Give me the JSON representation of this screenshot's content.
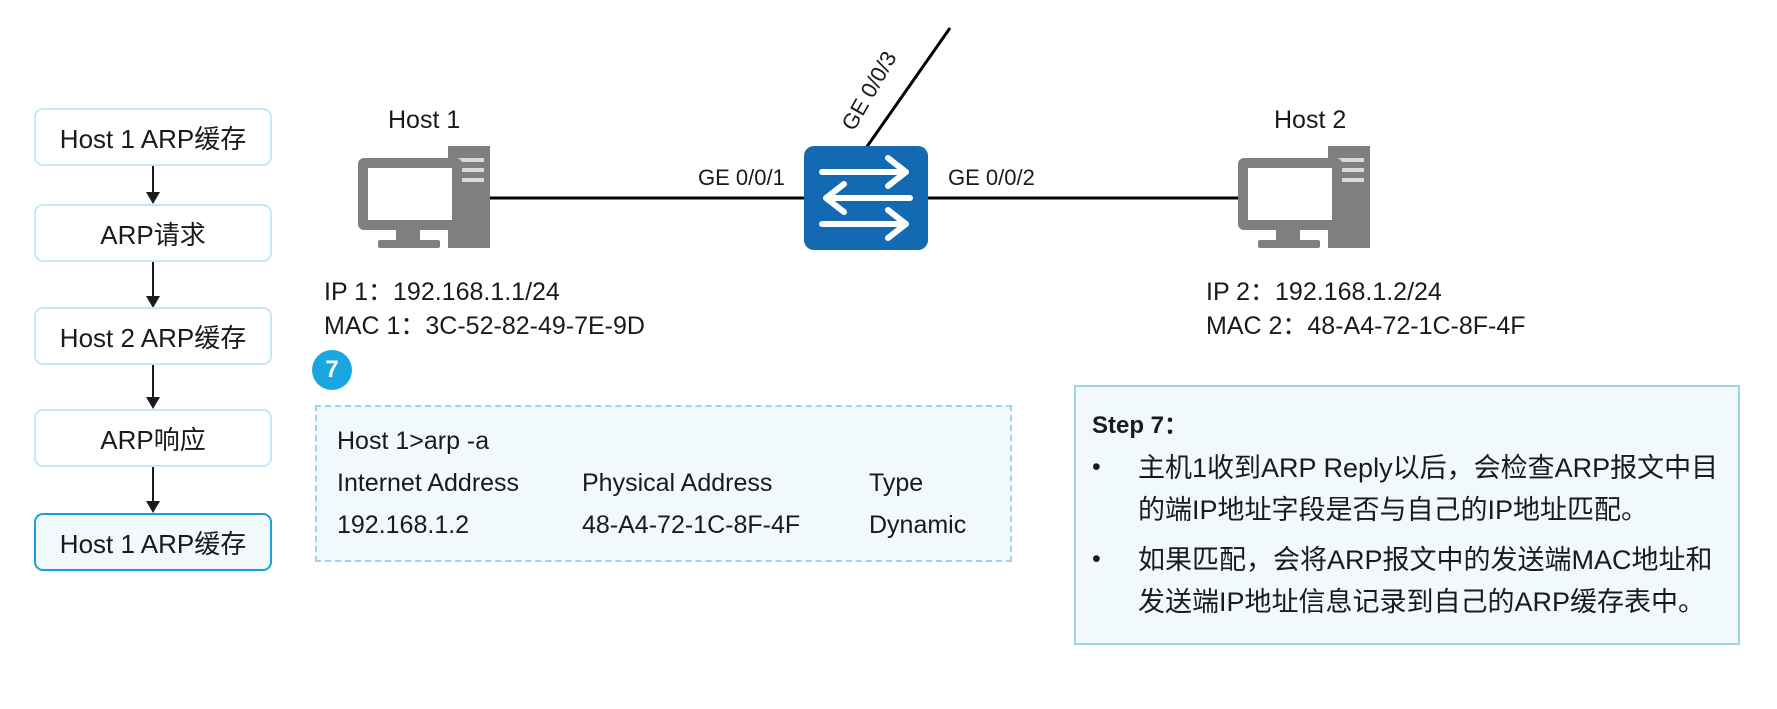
{
  "flow": {
    "steps": [
      {
        "label": "Host 1 ARP缓存"
      },
      {
        "label": "ARP请求"
      },
      {
        "label": "Host 2 ARP缓存"
      },
      {
        "label": "ARP响应"
      },
      {
        "label": "Host 1 ARP缓存"
      }
    ]
  },
  "topology": {
    "host1": {
      "name": "Host 1",
      "ip": "IP 1：192.168.1.1/24",
      "mac": "MAC 1：3C-52-82-49-7E-9D"
    },
    "host2": {
      "name": "Host 2",
      "ip": "IP 2：192.168.1.2/24",
      "mac": "MAC 2：48-A4-72-1C-8F-4F"
    },
    "ports": {
      "p1": "GE 0/0/1",
      "p2": "GE 0/0/2",
      "p3": "GE 0/0/3"
    }
  },
  "step_badge": "7",
  "arp_table": {
    "command": "Host 1>arp -a",
    "headers": [
      "Internet Address",
      "Physical Address",
      "Type"
    ],
    "row": [
      "192.168.1.2",
      "48-A4-72-1C-8F-4F",
      "Dynamic"
    ]
  },
  "note": {
    "title": "Step 7：",
    "bullets": [
      "主机1收到ARP Reply以后，会检查ARP报文中目的端IP地址字段是否与自己的IP地址匹配。",
      "如果匹配，会将ARP报文中的发送端MAC地址和发送端IP地址信息记录到自己的ARP缓存表中。"
    ]
  },
  "colors": {
    "accent": "#1aa7e0",
    "switch": "#1469b3",
    "panel_bg": "#f1f9fd",
    "panel_border": "#9fd3ea",
    "pc_gray": "#7f7f7f"
  }
}
